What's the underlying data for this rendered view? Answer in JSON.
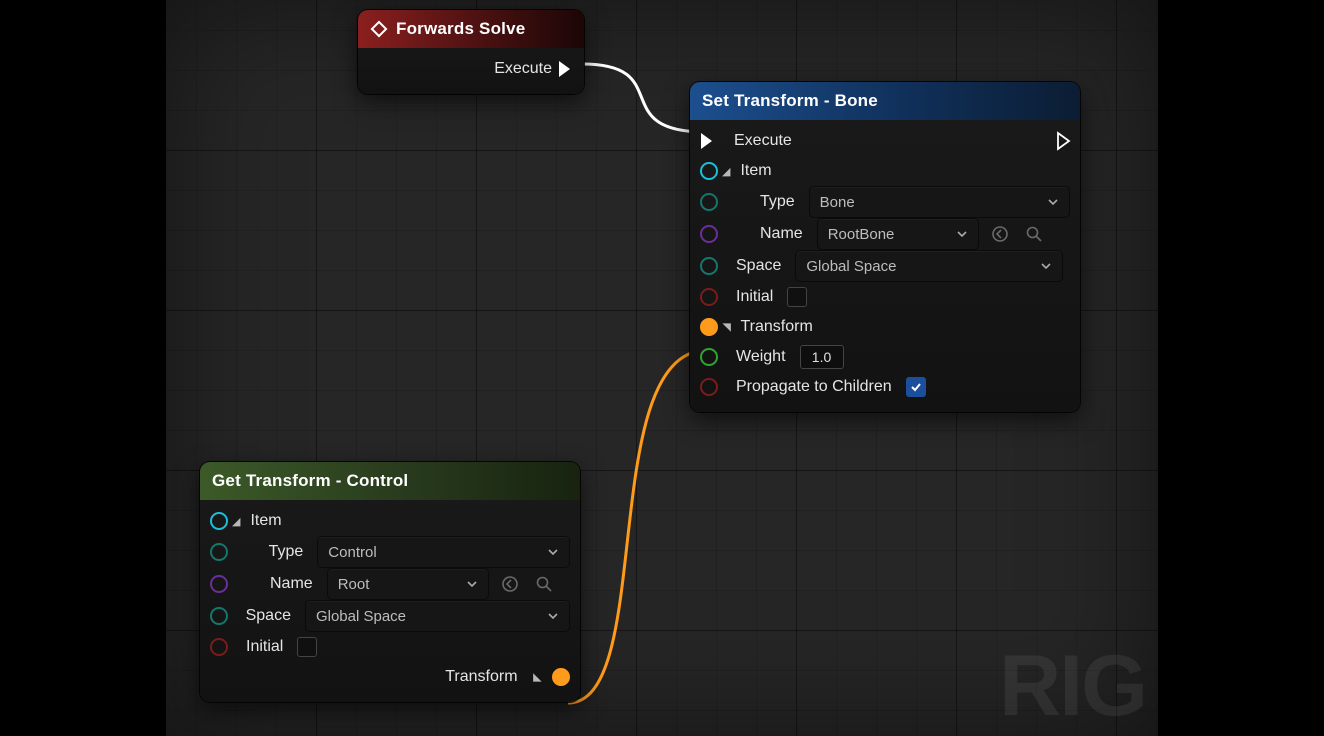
{
  "watermark": "RIG",
  "node_forwards": {
    "title": "Forwards Solve",
    "execute_label": "Execute"
  },
  "node_set": {
    "title": "Set Transform - Bone",
    "execute_label": "Execute",
    "item_label": "Item",
    "type_label": "Type",
    "type_value": "Bone",
    "name_label": "Name",
    "name_value": "RootBone",
    "space_label": "Space",
    "space_value": "Global Space",
    "initial_label": "Initial",
    "initial_checked": false,
    "transform_label": "Transform",
    "weight_label": "Weight",
    "weight_value": "1.0",
    "propagate_label": "Propagate to Children",
    "propagate_checked": true
  },
  "node_get": {
    "title": "Get Transform - Control",
    "item_label": "Item",
    "type_label": "Type",
    "type_value": "Control",
    "name_label": "Name",
    "name_value": "Root",
    "space_label": "Space",
    "space_value": "Global Space",
    "initial_label": "Initial",
    "initial_checked": false,
    "transform_label": "Transform"
  }
}
